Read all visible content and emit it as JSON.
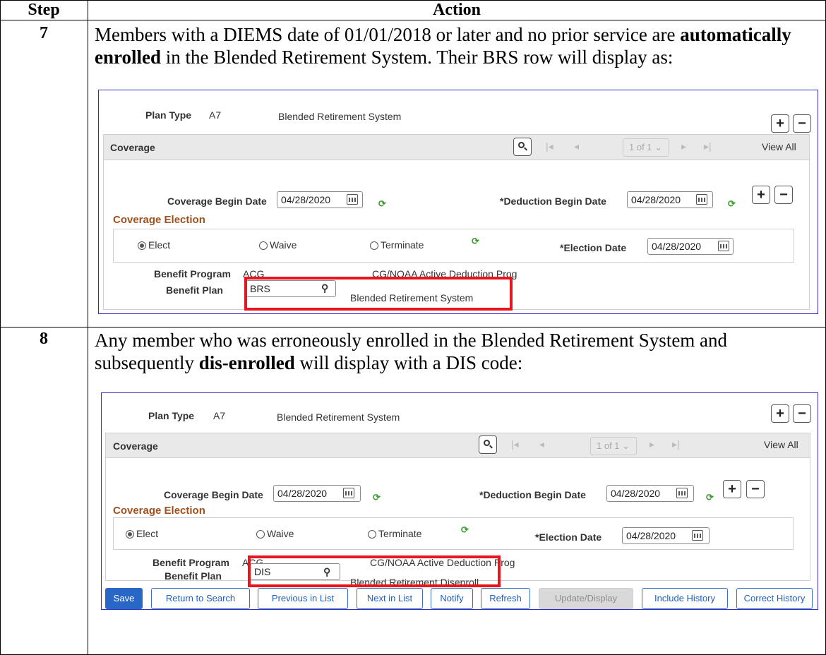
{
  "table": {
    "header_step": "Step",
    "header_action": "Action"
  },
  "steps": [
    {
      "number": "7",
      "text_before": "Members with a DIEMS date of 01/01/2018 or later and no prior service are ",
      "text_bold": "automatically enrolled",
      "text_after": " in the Blended Retirement System. Their BRS row will display as:"
    },
    {
      "number": "8",
      "text_before": "Any member who was erroneously enrolled in the Blended Retirement System and subsequently ",
      "text_bold": "dis-enrolled",
      "text_after": " will display with a DIS code:"
    }
  ],
  "screens": [
    {
      "plan_type_label": "Plan Type",
      "plan_type_code": "A7",
      "plan_type_desc": "Blended Retirement System",
      "coverage_title": "Coverage",
      "pager_text": "1 of 1",
      "view_all": "View All",
      "coverage_begin_label": "Coverage Begin Date",
      "coverage_begin_value": "04/28/2020",
      "deduction_begin_label": "*Deduction Begin Date",
      "deduction_begin_value": "04/28/2020",
      "coverage_election_title": "Coverage Election",
      "elect_label": "Elect",
      "waive_label": "Waive",
      "terminate_label": "Terminate",
      "election_date_label": "*Election Date",
      "election_date_value": "04/28/2020",
      "benefit_program_label": "Benefit Program",
      "benefit_program_code": "ACG",
      "benefit_program_desc": "CG/NOAA Active Deduction Prog",
      "benefit_plan_label": "Benefit Plan",
      "benefit_plan_value": "BRS",
      "benefit_plan_desc": "Blended Retirement System"
    },
    {
      "plan_type_label": "Plan Type",
      "plan_type_code": "A7",
      "plan_type_desc": "Blended Retirement System",
      "coverage_title": "Coverage",
      "pager_text": "1 of 1",
      "view_all": "View All",
      "coverage_begin_label": "Coverage Begin Date",
      "coverage_begin_value": "04/28/2020",
      "deduction_begin_label": "*Deduction Begin Date",
      "deduction_begin_value": "04/28/2020",
      "coverage_election_title": "Coverage Election",
      "elect_label": "Elect",
      "waive_label": "Waive",
      "terminate_label": "Terminate",
      "election_date_label": "*Election Date",
      "election_date_value": "04/28/2020",
      "benefit_program_label": "Benefit Program",
      "benefit_program_code": "ACG",
      "benefit_program_desc": "CG/NOAA Active Deduction Prog",
      "benefit_plan_label": "Benefit Plan",
      "benefit_plan_value": "DIS",
      "benefit_plan_desc": "Blended Retirement Disenroll"
    }
  ],
  "toolbar": {
    "save": "Save",
    "return_to_search": "Return to Search",
    "previous_in_list": "Previous in List",
    "next_in_list": "Next in List",
    "notify": "Notify",
    "refresh": "Refresh",
    "update_display": "Update/Display",
    "include_history": "Include History",
    "correct_history": "Correct History"
  },
  "colors": {
    "highlight_red": "#e8141e",
    "primary_blue": "#2867c5",
    "coverage_election_orange": "#a0521e",
    "refresh_green": "#3a9b2e"
  },
  "icons": [
    "plus-icon",
    "minus-icon",
    "search-icon",
    "calendar-icon",
    "refresh-icon",
    "first-page-icon",
    "previous-icon",
    "next-icon",
    "last-page-icon",
    "chevron-down-icon"
  ]
}
